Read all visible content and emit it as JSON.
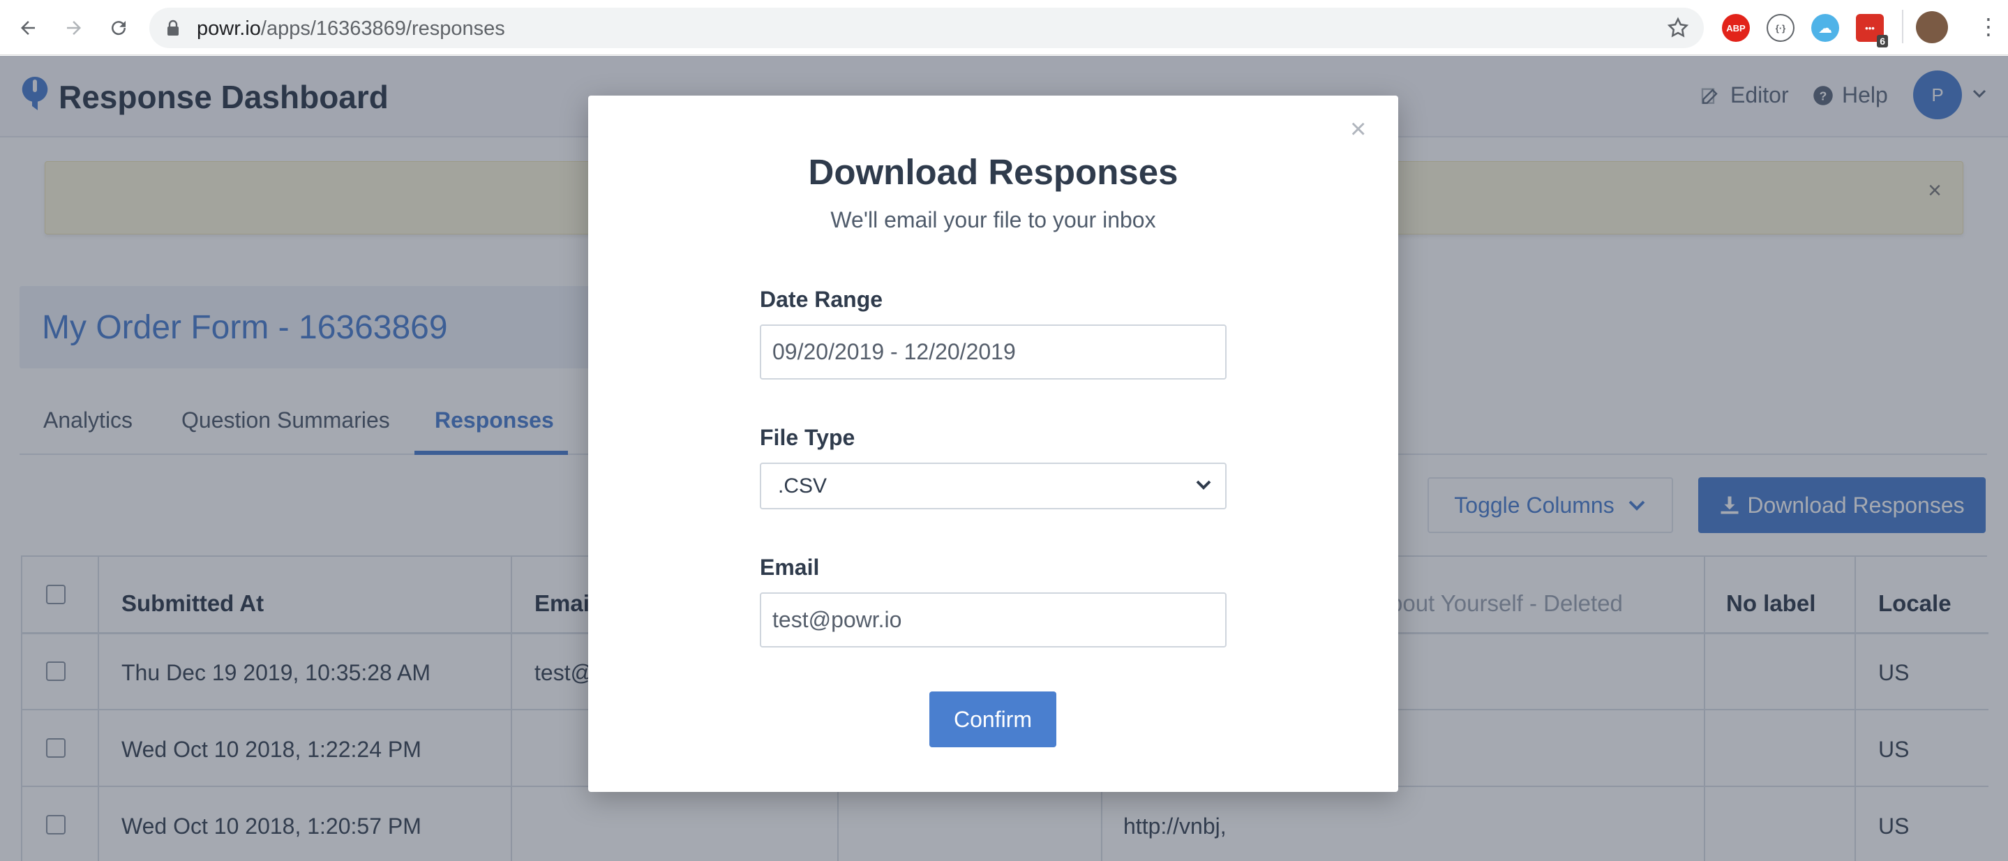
{
  "browser": {
    "url_domain": "powr.io",
    "url_path": "/apps/16363869/responses",
    "extensions": [
      {
        "name": "adblock-plus-icon",
        "label": "ABP",
        "color": "#e2231a"
      },
      {
        "name": "code-extension-icon",
        "label": "{·}",
        "color": "#5f6368"
      },
      {
        "name": "cloud-extension-icon",
        "label": "☁",
        "color": "#4fb3e8"
      },
      {
        "name": "mail-extension-icon",
        "label": "•••",
        "badge": "6",
        "color": "#d93025"
      }
    ]
  },
  "header": {
    "title": "Response Dashboard",
    "editor_label": "Editor",
    "help_label": "Help",
    "avatar_initial": "P"
  },
  "banner": {
    "close": "×"
  },
  "form": {
    "title": "My Order Form - 16363869"
  },
  "tabs": [
    {
      "label": "Analytics"
    },
    {
      "label": "Question Summaries"
    },
    {
      "label": "Responses",
      "active": true
    }
  ],
  "toolbar": {
    "toggle_columns": "Toggle Columns",
    "download_responses": "Download Responses"
  },
  "table": {
    "headers": [
      "Submitted At",
      "Email",
      "bout Yourself - Deleted",
      "No label",
      "Locale"
    ],
    "rows": [
      {
        "submitted_at": "Thu Dec 19 2019, 10:35:28 AM",
        "email": "test@",
        "link": "",
        "locale": "US"
      },
      {
        "submitted_at": "Wed Oct 10 2018, 1:22:24 PM",
        "email": "",
        "link": "",
        "locale": "US"
      },
      {
        "submitted_at": "Wed Oct 10 2018, 1:20:57 PM",
        "email": "",
        "link": "http://vnbj,",
        "locale": "US"
      }
    ]
  },
  "modal": {
    "close": "×",
    "title": "Download Responses",
    "subtitle": "We'll email your file to your inbox",
    "date_range_label": "Date Range",
    "date_range_value": "09/20/2019 - 12/20/2019",
    "file_type_label": "File Type",
    "file_type_value": ".CSV",
    "email_label": "Email",
    "email_value": "test@powr.io",
    "confirm": "Confirm"
  },
  "colors": {
    "accent": "#4a7fcf",
    "overlay": "rgba(40,50,70,0.42)"
  }
}
